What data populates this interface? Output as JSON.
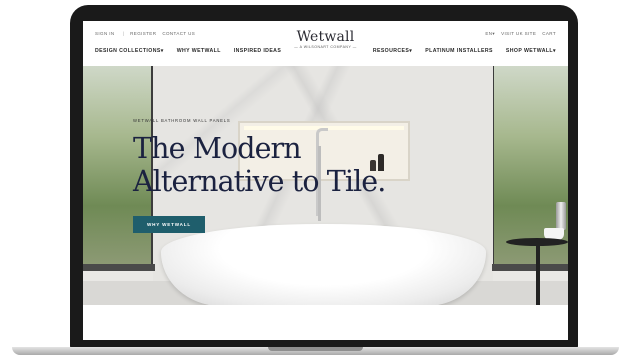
{
  "utility_nav": {
    "sign_in": "SIGN IN",
    "divider": "|",
    "register": "REGISTER",
    "contact_us": "CONTACT US",
    "language": "EN▾",
    "visit_uk_site": "VISIT UK SITE",
    "cart": "CART"
  },
  "brand": {
    "logo_text": "Wetwall",
    "logo_subtext": "— A WILSONART COMPANY —"
  },
  "main_nav": {
    "left": [
      "DESIGN COLLECTIONS▾",
      "WHY WETWALL",
      "INSPIRED IDEAS"
    ],
    "right": [
      "RESOURCES▾",
      "PLATINUM INSTALLERS",
      "SHOP WETWALL▾"
    ]
  },
  "hero": {
    "eyebrow": "WETWALL BATHROOM WALL PANELS",
    "headline_line1": "The Modern",
    "headline_line2": "Alternative to Tile.",
    "cta_label": "WHY WETWALL"
  },
  "colors": {
    "cta_background": "#1f5e6c",
    "headline_color": "#1b2240",
    "laptop_bezel": "#1a1a1a"
  }
}
